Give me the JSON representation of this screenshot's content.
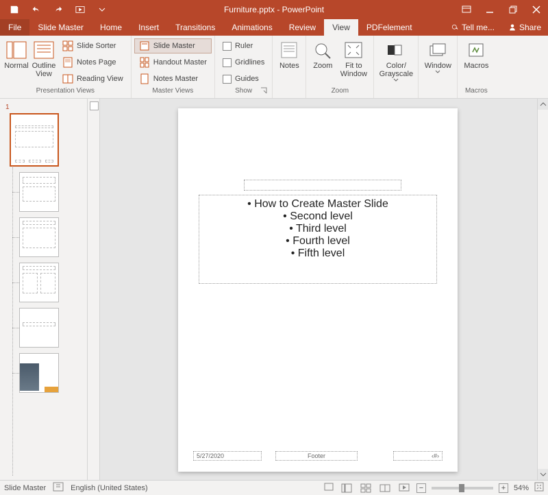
{
  "titlebar": {
    "filename": "Furniture.pptx",
    "app": "PowerPoint",
    "separator": " - ",
    "qat_items": [
      "save-icon",
      "undo-icon",
      "redo-icon",
      "start-from-beginning-icon"
    ]
  },
  "tabs": {
    "file": "File",
    "items": [
      "Slide Master",
      "Home",
      "Insert",
      "Transitions",
      "Animations",
      "Review",
      "View",
      "PDFelement"
    ],
    "active_index": 6,
    "tellme": "Tell me...",
    "share": "Share"
  },
  "ribbon": {
    "presentation_views": {
      "label": "Presentation Views",
      "normal": "Normal",
      "outline": "Outline View",
      "slide_sorter": "Slide Sorter",
      "notes_page": "Notes Page",
      "reading_view": "Reading View"
    },
    "master_views": {
      "label": "Master Views",
      "slide_master": "Slide Master",
      "handout_master": "Handout Master",
      "notes_master": "Notes Master",
      "active": "slide_master"
    },
    "show": {
      "label": "Show",
      "ruler": "Ruler",
      "gridlines": "Gridlines",
      "guides": "Guides"
    },
    "notes": {
      "label": "Notes"
    },
    "zoom": {
      "label": "Zoom",
      "zoom": "Zoom",
      "fit": "Fit to Window"
    },
    "color": {
      "label": "",
      "btn": "Color/ Grayscale"
    },
    "window": {
      "label": "",
      "btn": "Window"
    },
    "macros": {
      "label": "Macros",
      "btn": "Macros"
    }
  },
  "thumbnails": {
    "master_number": "1"
  },
  "slide": {
    "bullets": [
      "How to Create Master Slide",
      "Second level",
      "Third level",
      "Fourth level",
      "Fifth level"
    ],
    "footer_date": "5/27/2020",
    "footer_mid": "Footer",
    "footer_num": "‹#›"
  },
  "statusbar": {
    "view_label": "Slide Master",
    "language": "English (United States)",
    "zoom": "54%"
  }
}
